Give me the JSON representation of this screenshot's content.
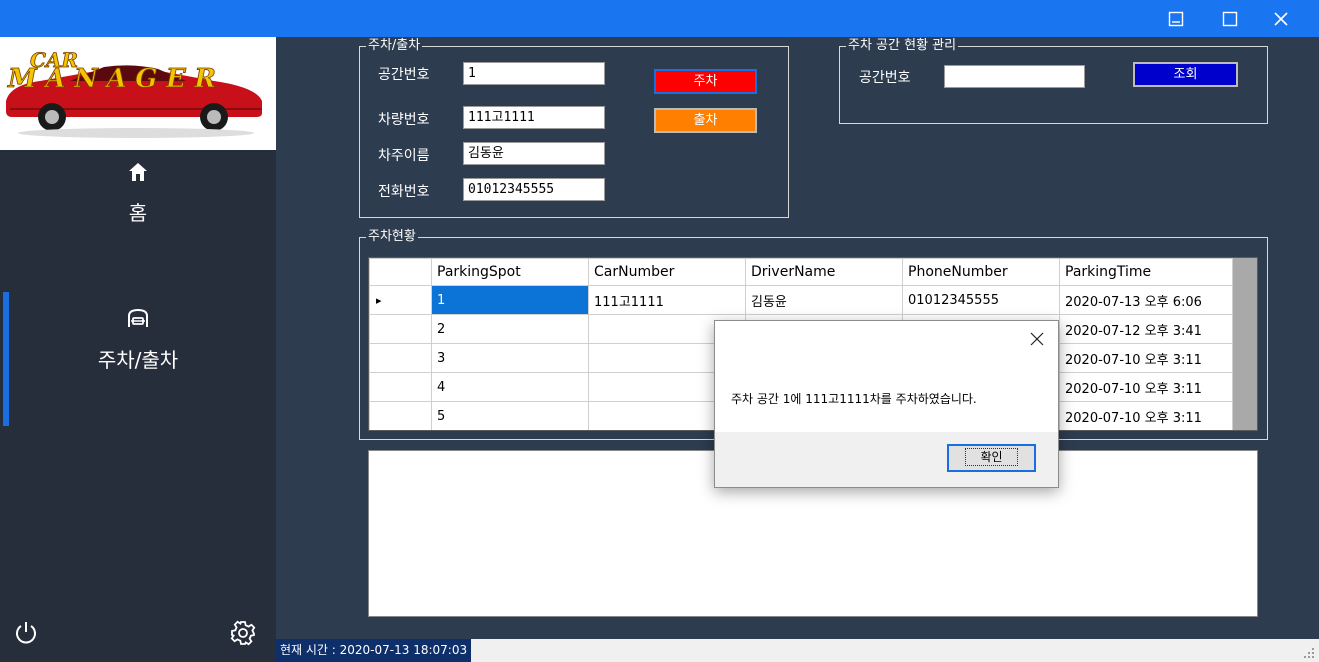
{
  "window": {
    "controls": [
      "minimize-icon",
      "maximize-icon",
      "close-icon"
    ]
  },
  "sidebar": {
    "logo_text_line1": "CAR",
    "logo_text_line2": "MANAGER",
    "items": [
      {
        "icon": "home-icon",
        "label": "홈",
        "active": false
      },
      {
        "icon": "car-icon",
        "label": "주차/출차",
        "active": true
      }
    ],
    "bottom_icons": [
      "power-icon",
      "gear-icon"
    ]
  },
  "parking_group": {
    "title": "주차/출차",
    "fields": [
      {
        "label": "공간번호",
        "value": "1"
      },
      {
        "label": "차량번호",
        "value": "111고1111"
      },
      {
        "label": "차주이름",
        "value": "김동윤"
      },
      {
        "label": "전화번호",
        "value": "01012345555"
      }
    ],
    "park_button": "주차",
    "exit_button": "출차"
  },
  "space_group": {
    "title": "주차 공간 현황 관리",
    "label": "공간번호",
    "value": "",
    "lookup_button": "조회"
  },
  "status_group": {
    "title": "주차현황",
    "columns": [
      "ParkingSpot",
      "CarNumber",
      "DriverName",
      "PhoneNumber",
      "ParkingTime"
    ],
    "rows": [
      [
        "1",
        "111고1111",
        "김동윤",
        "01012345555",
        "2020-07-13 오후 6:06"
      ],
      [
        "2",
        "",
        "",
        "",
        "2020-07-12 오후 3:41"
      ],
      [
        "3",
        "",
        "",
        "",
        "2020-07-10 오후 3:11"
      ],
      [
        "4",
        "",
        "",
        "",
        "2020-07-10 오후 3:11"
      ],
      [
        "5",
        "",
        "",
        "",
        "2020-07-10 오후 3:11"
      ]
    ],
    "current_row_marker": "▸"
  },
  "statusbar": {
    "text": "현재 시간 : 2020-07-13 18:07:03"
  },
  "dialog": {
    "message": "주차 공간 1에 111고1111차를 주차하였습니다.",
    "ok_label": "확인"
  },
  "colors": {
    "titlebar": "#1a75f0",
    "sidebar": "#262d3b",
    "main_bg": "#2e3c50",
    "park_button": "#ff0000",
    "exit_button": "#ff8000",
    "lookup_button": "#0000cc",
    "selected_cell": "#0c74d6"
  }
}
